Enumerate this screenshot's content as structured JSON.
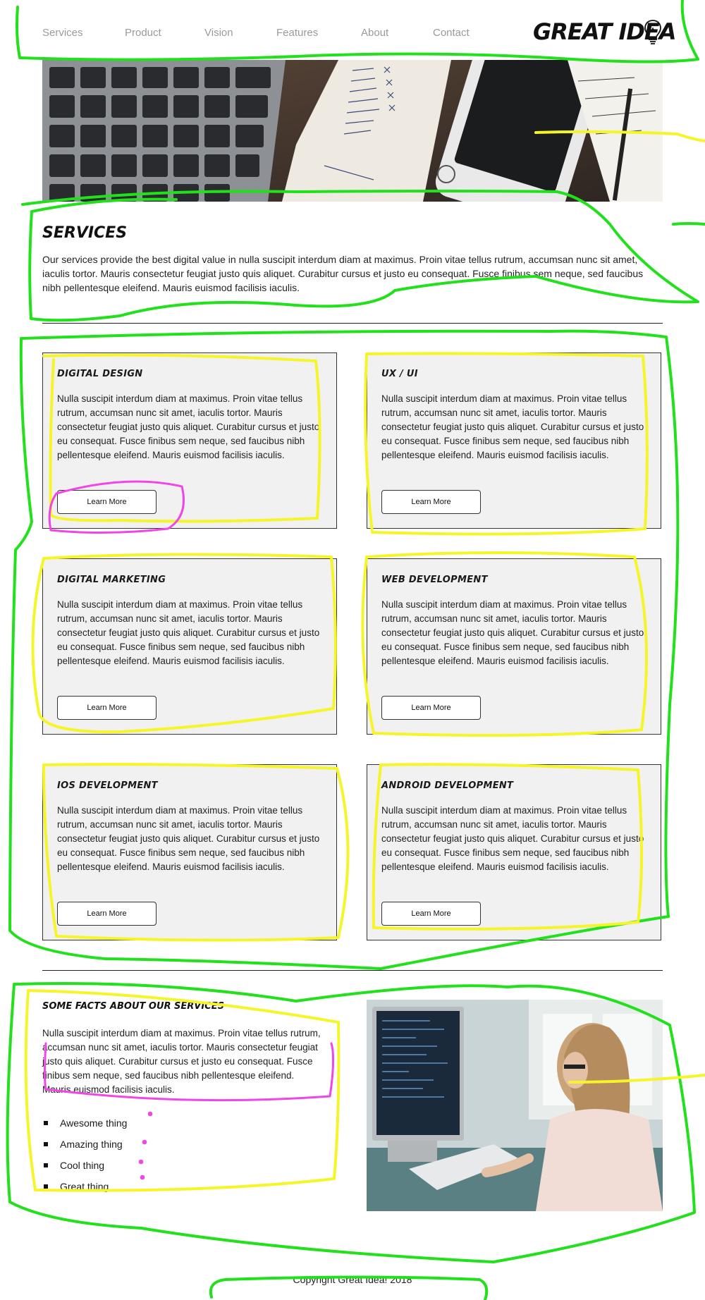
{
  "nav": {
    "items": [
      "Services",
      "Product",
      "Vision",
      "Features",
      "About",
      "Contact"
    ],
    "logo": "GREAT IDEA"
  },
  "services": {
    "title": "SERVICES",
    "intro": "Our services provide the best digital value in nulla suscipit interdum diam at maximus. Proin vitae tellus rutrum, accumsan nunc sit amet, iaculis tortor. Mauris consectetur feugiat justo quis aliquet. Curabitur cursus et justo eu consequat. Fusce finibus sem neque, sed faucibus nibh pellentesque eleifend. Mauris euismod facilisis iaculis.",
    "cards": [
      {
        "title": "DIGITAL DESIGN",
        "text": "Nulla suscipit interdum diam at maximus. Proin vitae tellus rutrum, accumsan nunc sit amet, iaculis tortor. Mauris consectetur feugiat justo quis aliquet. Curabitur cursus et justo eu consequat. Fusce finibus sem neque, sed faucibus nibh pellentesque eleifend. Mauris euismod facilisis iaculis.",
        "button": "Learn More"
      },
      {
        "title": "UX / UI",
        "text": "Nulla suscipit interdum diam at maximus. Proin vitae tellus rutrum, accumsan nunc sit amet, iaculis tortor. Mauris consectetur feugiat justo quis aliquet. Curabitur cursus et justo eu consequat. Fusce finibus sem neque, sed faucibus nibh pellentesque eleifend. Mauris euismod facilisis iaculis.",
        "button": "Learn More"
      },
      {
        "title": "DIGITAL MARKETING",
        "text": "Nulla suscipit interdum diam at maximus. Proin vitae tellus rutrum, accumsan nunc sit amet, iaculis tortor. Mauris consectetur feugiat justo quis aliquet. Curabitur cursus et justo eu consequat. Fusce finibus sem neque, sed faucibus nibh pellentesque eleifend. Mauris euismod facilisis iaculis.",
        "button": "Learn More"
      },
      {
        "title": "WEB DEVELOPMENT",
        "text": "Nulla suscipit interdum diam at maximus. Proin vitae tellus rutrum, accumsan nunc sit amet, iaculis tortor. Mauris consectetur feugiat justo quis aliquet. Curabitur cursus et justo eu consequat. Fusce finibus sem neque, sed faucibus nibh pellentesque eleifend. Mauris euismod facilisis iaculis.",
        "button": "Learn More"
      },
      {
        "title": "IOS DEVELOPMENT",
        "text": "Nulla suscipit interdum diam at maximus. Proin vitae tellus rutrum, accumsan nunc sit amet, iaculis tortor. Mauris consectetur feugiat justo quis aliquet. Curabitur cursus et justo eu consequat. Fusce finibus sem neque, sed faucibus nibh pellentesque eleifend. Mauris euismod facilisis iaculis.",
        "button": "Learn More"
      },
      {
        "title": "ANDROID DEVELOPMENT",
        "text": "Nulla suscipit interdum diam at maximus. Proin vitae tellus rutrum, accumsan nunc sit amet, iaculis tortor. Mauris consectetur feugiat justo quis aliquet. Curabitur cursus et justo eu consequat. Fusce finibus sem neque, sed faucibus nibh pellentesque eleifend. Mauris euismod facilisis iaculis.",
        "button": "Learn More"
      }
    ]
  },
  "facts": {
    "title": "SOME FACTS ABOUT OUR SERVICES",
    "text": "Nulla suscipit interdum diam at maximus. Proin vitae tellus rutrum, accumsan nunc sit amet, iaculis tortor. Mauris consectetur feugiat justo quis aliquet. Curabitur cursus et justo eu consequat. Fusce finibus sem neque, sed faucibus nibh pellentesque eleifend. Mauris euismod facilisis iaculis.",
    "list": [
      "Awesome thing",
      "Amazing thing",
      "Cool thing",
      "Great thing"
    ]
  },
  "footer": {
    "copyright": "Copyright Great Idea! 2018"
  },
  "colors": {
    "annotation_green": "#22e01c",
    "annotation_yellow": "#f5f52a",
    "annotation_magenta": "#f046e8",
    "card_bg": "#f1f1f1"
  }
}
